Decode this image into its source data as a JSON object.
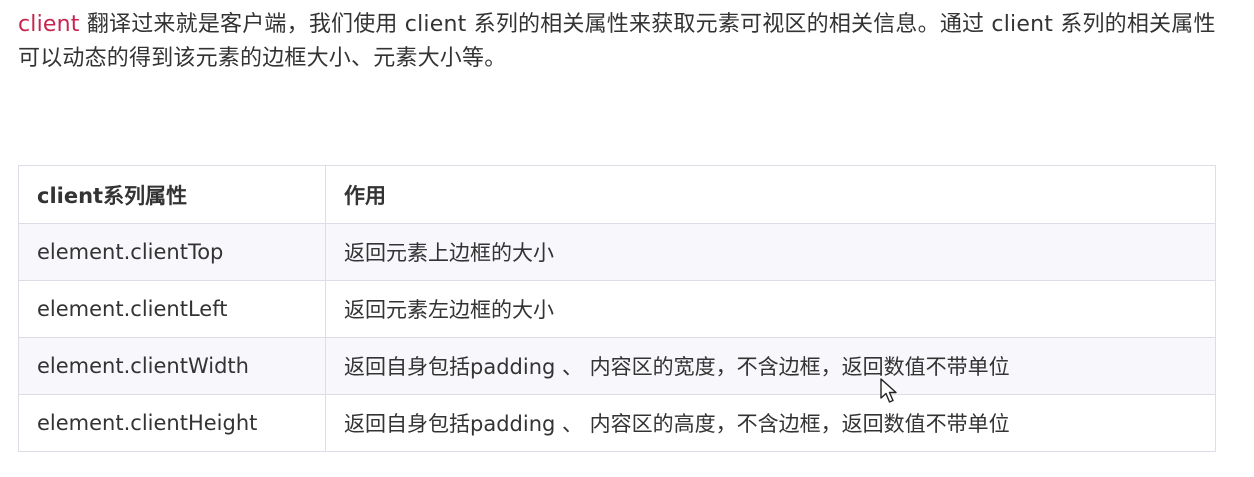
{
  "intro": {
    "keyword": "client",
    "text": " 翻译过来就是客户端，我们使用 client 系列的相关属性来获取元素可视区的相关信息。通过 client 系列的相关属性可以动态的得到该元素的边框大小、元素大小等。"
  },
  "table": {
    "headers": [
      "client系列属性",
      "作用"
    ],
    "rows": [
      [
        "element.clientTop",
        "返回元素上边框的大小"
      ],
      [
        "element.clientLeft",
        "返回元素左边框的大小"
      ],
      [
        "element.clientWidth",
        "返回自身包括padding 、 内容区的宽度，不含边框，返回数值不带单位"
      ],
      [
        "element.clientHeight",
        "返回自身包括padding 、 内容区的高度，不含边框，返回数值不带单位"
      ]
    ]
  },
  "colors": {
    "keyword": "#c7254e",
    "text": "#333333",
    "border": "#dddde6",
    "stripe": "#f8f7fb"
  },
  "icons": {
    "cursor": "mouse-pointer-icon"
  }
}
